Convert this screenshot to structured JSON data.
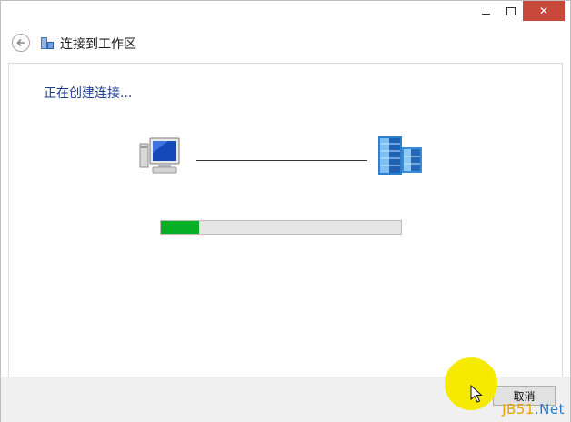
{
  "window": {
    "controls": {
      "minimize": "–",
      "maximize": "□",
      "close": "✕"
    }
  },
  "nav": {
    "back_icon": "back-arrow-icon",
    "title_icon": "workplace-network-icon",
    "title": "连接到工作区"
  },
  "main": {
    "status_heading": "正在创建连接...",
    "left_icon": "computer-icon",
    "right_icon": "server-icon",
    "progress_fraction": 0.16
  },
  "footer": {
    "cancel_label": "取消"
  },
  "overlay": {
    "watermark_prefix": "JB51",
    "watermark_suffix": ".Net",
    "watermark_prefix_color": "#e8a100",
    "watermark_suffix_color": "#2a79c6",
    "highlight_color": "#f5ea00"
  },
  "colors": {
    "accent_heading": "#1e3f8f",
    "progress_fill": "#06b025",
    "close_button": "#c7493b"
  }
}
